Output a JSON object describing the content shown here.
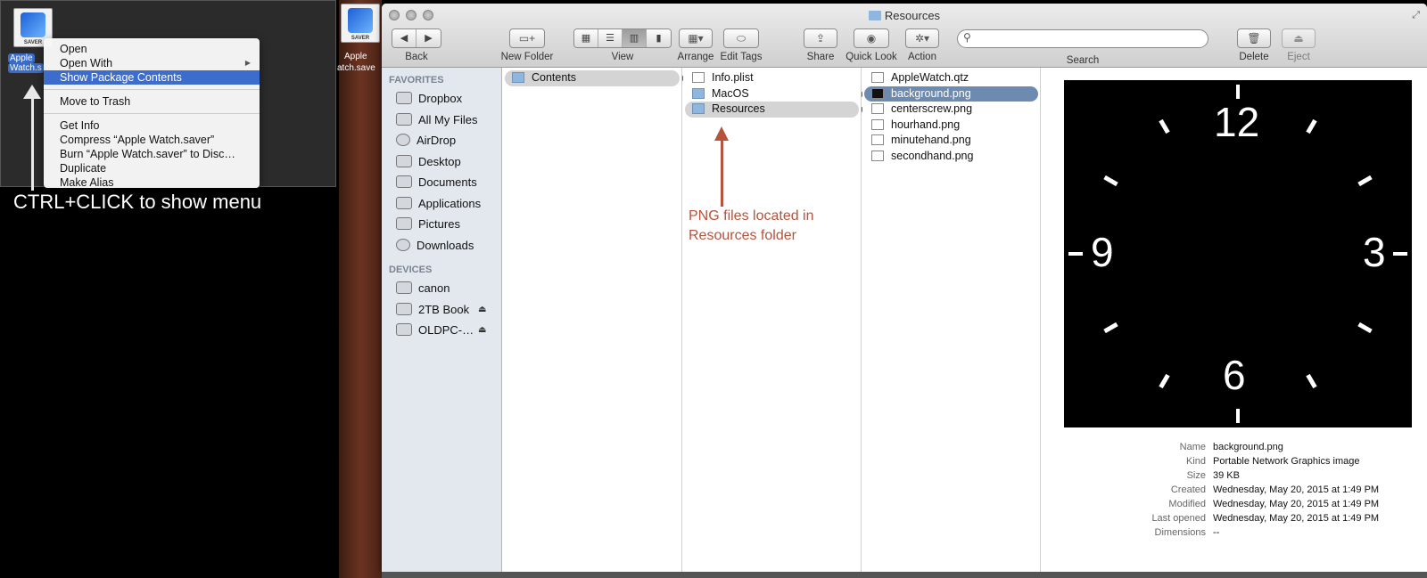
{
  "left_panel": {
    "icon_tag": "SAVER",
    "icon_label_1": "Apple",
    "icon_label_2": "Watch.s",
    "menu": [
      {
        "label": "Open",
        "selected": false,
        "submenu": false
      },
      {
        "label": "Open With",
        "selected": false,
        "submenu": true
      },
      {
        "label": "Show Package Contents",
        "selected": true,
        "submenu": false
      },
      {
        "sep": true
      },
      {
        "label": "Move to Trash",
        "selected": false,
        "submenu": false
      },
      {
        "sep": true
      },
      {
        "label": "Get Info",
        "selected": false,
        "submenu": false
      },
      {
        "label": "Compress “Apple Watch.saver”",
        "selected": false,
        "submenu": false
      },
      {
        "label": "Burn “Apple Watch.saver” to Disc…",
        "selected": false,
        "submenu": false
      },
      {
        "label": "Duplicate",
        "selected": false,
        "submenu": false
      },
      {
        "label": "Make Alias",
        "selected": false,
        "submenu": false
      }
    ],
    "instruction": "CTRL+CLICK to show menu",
    "second_icon_tag": "SAVER",
    "second_icon_label_1": "Apple",
    "second_icon_label_2": "atch.save"
  },
  "finder": {
    "title": "Resources",
    "toolbar": {
      "back": "Back",
      "new_folder": "New Folder",
      "view": "View",
      "arrange": "Arrange",
      "edit_tags": "Edit Tags",
      "share": "Share",
      "quick_look": "Quick Look",
      "action": "Action",
      "search": "Search",
      "search_value": "",
      "delete": "Delete",
      "eject": "Eject"
    },
    "sidebar": {
      "favorites_heading": "FAVORITES",
      "favorites": [
        "Dropbox",
        "All My Files",
        "AirDrop",
        "Desktop",
        "Documents",
        "Applications",
        "Pictures",
        "Downloads"
      ],
      "devices_heading": "DEVICES",
      "devices": [
        {
          "label": "canon",
          "eject": false
        },
        {
          "label": "2TB Book",
          "eject": true
        },
        {
          "label": "OLDPC-…",
          "eject": true
        }
      ]
    },
    "columns": [
      [
        {
          "label": "Contents",
          "type": "folder",
          "selected": "grey",
          "disclose": true
        }
      ],
      [
        {
          "label": "Info.plist",
          "type": "file",
          "selected": "",
          "disclose": false
        },
        {
          "label": "MacOS",
          "type": "folder",
          "selected": "",
          "disclose": true
        },
        {
          "label": "Resources",
          "type": "folder",
          "selected": "grey",
          "disclose": true
        }
      ],
      [
        {
          "label": "AppleWatch.qtz",
          "type": "file",
          "selected": "",
          "disclose": false
        },
        {
          "label": "background.png",
          "type": "black",
          "selected": "blue",
          "disclose": false
        },
        {
          "label": "centerscrew.png",
          "type": "file",
          "selected": "",
          "disclose": false
        },
        {
          "label": "hourhand.png",
          "type": "file",
          "selected": "",
          "disclose": false
        },
        {
          "label": "minutehand.png",
          "type": "file",
          "selected": "",
          "disclose": false
        },
        {
          "label": "secondhand.png",
          "type": "file",
          "selected": "",
          "disclose": false
        }
      ]
    ],
    "annotation": "PNG files located in Resources folder",
    "preview_numbers": {
      "n12": "12",
      "n3": "3",
      "n6": "6",
      "n9": "9"
    },
    "info": [
      {
        "key": "Name",
        "val": "background.png"
      },
      {
        "key": "Kind",
        "val": "Portable Network Graphics image"
      },
      {
        "key": "Size",
        "val": "39 KB"
      },
      {
        "key": "Created",
        "val": "Wednesday, May 20, 2015 at 1:49 PM"
      },
      {
        "key": "Modified",
        "val": "Wednesday, May 20, 2015 at 1:49 PM"
      },
      {
        "key": "Last opened",
        "val": "Wednesday, May 20, 2015 at 1:49 PM"
      },
      {
        "key": "Dimensions",
        "val": "--"
      }
    ]
  }
}
